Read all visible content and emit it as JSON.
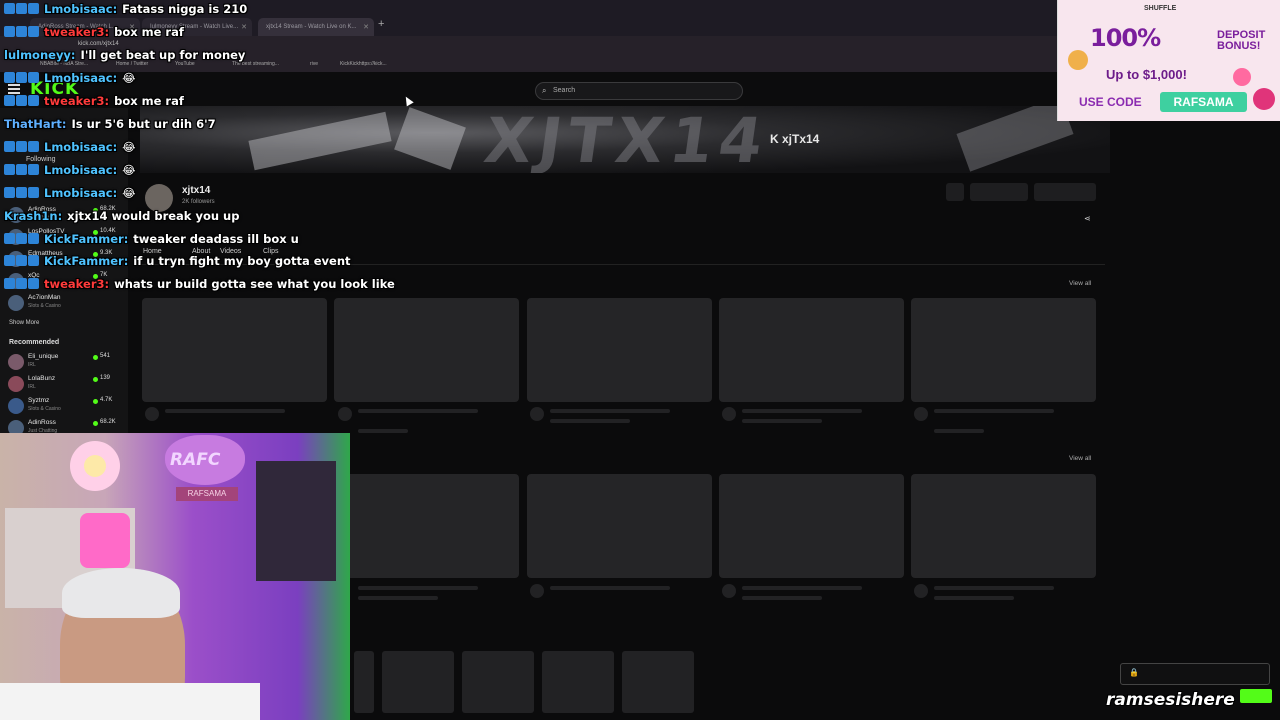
{
  "browser": {
    "tabs": [
      {
        "label": "AdinRoss Stream - Watch L..."
      },
      {
        "label": "Iulmoneyy Stream - Watch Live..."
      },
      {
        "label": "xjtx14 Stream - Watch Live on K..."
      }
    ],
    "new_tab": "+",
    "url": "kick.com/xjtx14",
    "bookmarks": [
      "NBABite - NBA Stre...",
      "Home / Twitter",
      "YouTube",
      "The best streaming...",
      "rive",
      "KickKickhttps://kick..."
    ]
  },
  "kick": {
    "logo": "KICK",
    "search": {
      "placeholder": "Search",
      "icon": "search-icon"
    },
    "banner": {
      "text": "XJTX14",
      "handle": "K xjTx14"
    },
    "sidebar": {
      "heading": "Following",
      "following": [
        {
          "name": "AdinRoss",
          "category": "Just Chatting",
          "viewers": "68.2K"
        },
        {
          "name": "LosPollosTV",
          "category": "",
          "viewers": "10.4K"
        },
        {
          "name": "Edmattheus",
          "category": "",
          "viewers": "9.3K"
        },
        {
          "name": "xQc",
          "category": "",
          "viewers": "7K"
        },
        {
          "name": "Ac7ionMan",
          "category": "Slots & Casino",
          "viewers": ""
        }
      ],
      "show_more": "Show More",
      "recommended_heading": "Recommended",
      "recommended": [
        {
          "name": "Eli_unique",
          "category": "IRL",
          "viewers": "541"
        },
        {
          "name": "LolaBunz",
          "category": "IRL",
          "viewers": "139"
        },
        {
          "name": "Syztmz",
          "category": "Slots & Casino",
          "viewers": "4.7K"
        },
        {
          "name": "AdinRoss",
          "category": "Just Chatting",
          "viewers": "68.2K"
        }
      ]
    },
    "channel": {
      "name": "xjtx14",
      "followers": "2K followers",
      "tabs": [
        "Home",
        "About",
        "Videos",
        "Clips"
      ]
    },
    "sections": [
      {
        "view_all": "View all"
      },
      {
        "view_all": "View all"
      }
    ]
  },
  "chat": [
    {
      "user": "Lmobisaac:",
      "text": "Fatass nigga is 210",
      "color": "#4fc3ff"
    },
    {
      "user": "tweaker3:",
      "text": "box me raf",
      "color": "#ff3b3b"
    },
    {
      "user": "lulmoneyy:",
      "text": "I'll get beat up for money",
      "color": "#4fc3ff"
    },
    {
      "user": "Lmobisaac:",
      "text": "😂",
      "color": "#4fc3ff"
    },
    {
      "user": "tweaker3:",
      "text": "box me raf",
      "color": "#ff3b3b"
    },
    {
      "user": "ThatHart:",
      "text": "Is ur 5'6 but ur dih 6'7",
      "color": "#5fb0ff"
    },
    {
      "user": "Lmobisaac:",
      "text": "😂",
      "color": "#4fc3ff"
    },
    {
      "user": "Lmobisaac:",
      "text": "😂",
      "color": "#4fc3ff"
    },
    {
      "user": "Lmobisaac:",
      "text": "😂",
      "color": "#4fc3ff"
    },
    {
      "user": "Krash1n:",
      "text": "xjtx14 would break you up",
      "color": "#4fc3ff"
    },
    {
      "user": "KickFammer:",
      "text": "tweaker deadass ill box u",
      "color": "#4fc3ff"
    },
    {
      "user": "KickFammer:",
      "text": "if u tryn fight my boy gotta event",
      "color": "#4fc3ff"
    },
    {
      "user": "tweaker3:",
      "text": "whats ur build gotta see what you look like",
      "color": "#ff3b3b"
    }
  ],
  "ad": {
    "brand": "SHUFFLE",
    "headline": "100%",
    "deposit": "DEPOSIT",
    "bonus": "BONUS!",
    "subline": "Up to $1,000!",
    "use_code": "USE CODE",
    "code": "RAFSAMA"
  },
  "webcam": {
    "sign": "RAFC",
    "label": "RAFSAMA"
  },
  "watermark": "ramsesishere",
  "colors": {
    "kick_green": "#53fc18",
    "page_bg": "#0b0b0c"
  }
}
